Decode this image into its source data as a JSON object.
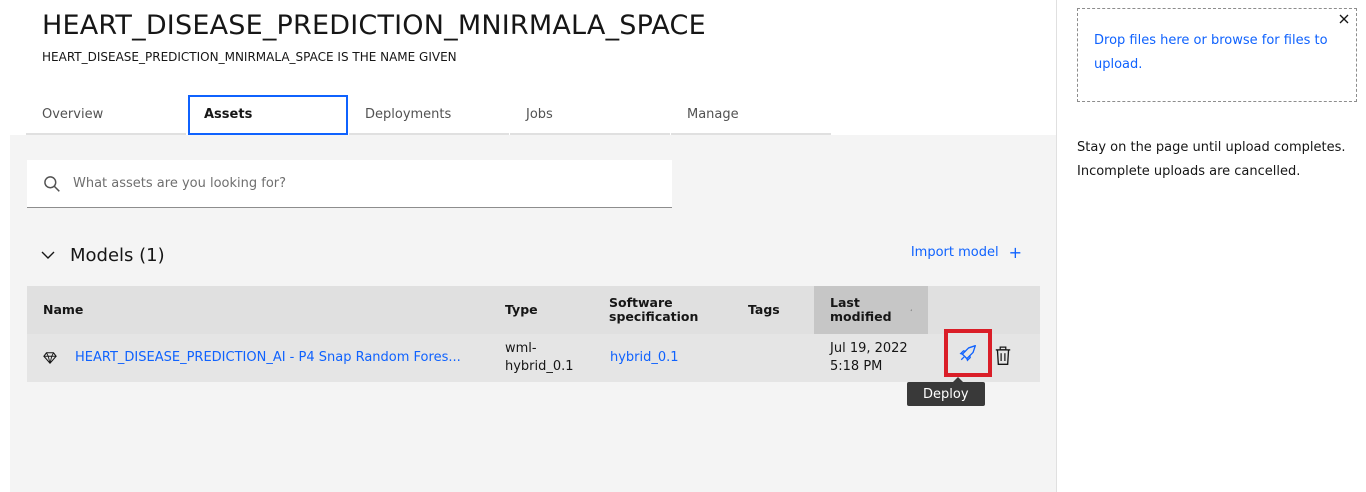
{
  "header": {
    "title": "HEART_DISEASE_PREDICTION_MNIRMALA_SPACE",
    "subtitle": "HEART_DISEASE_PREDICTION_MNIRMALA_SPACE IS THE NAME GIVEN"
  },
  "tabs": [
    {
      "label": "Overview",
      "active": false
    },
    {
      "label": "Assets",
      "active": true
    },
    {
      "label": "Deployments",
      "active": false
    },
    {
      "label": "Jobs",
      "active": false
    },
    {
      "label": "Manage",
      "active": false
    }
  ],
  "search": {
    "placeholder": "What assets are you looking for?",
    "icon": "search-icon"
  },
  "models": {
    "section_title": "Models (1)",
    "import_label": "Import model",
    "import_plus": "+",
    "columns": {
      "name": "Name",
      "type": "Type",
      "software_1": "Software",
      "software_2": "specification",
      "tags": "Tags",
      "modified_1": "Last",
      "modified_2": "modified"
    },
    "rows": [
      {
        "name": "HEART_DISEASE_PREDICTION_AI - P4 Snap Random Fores...",
        "type_1": "wml-",
        "type_2": "hybrid_0.1",
        "software": "hybrid_0.1",
        "tags": "",
        "modified_1": "Jul 19, 2022",
        "modified_2": "5:18 PM"
      }
    ],
    "tooltip": "Deploy"
  },
  "upload_panel": {
    "drop_text": "Drop files here or browse for files to upload.",
    "note": "Stay on the page until upload completes. Incomplete uploads are cancelled."
  },
  "colors": {
    "accent": "#0f62fe",
    "highlight": "#da1e28",
    "table_header": "#e0e0e0",
    "content_bg": "#f4f4f4"
  }
}
